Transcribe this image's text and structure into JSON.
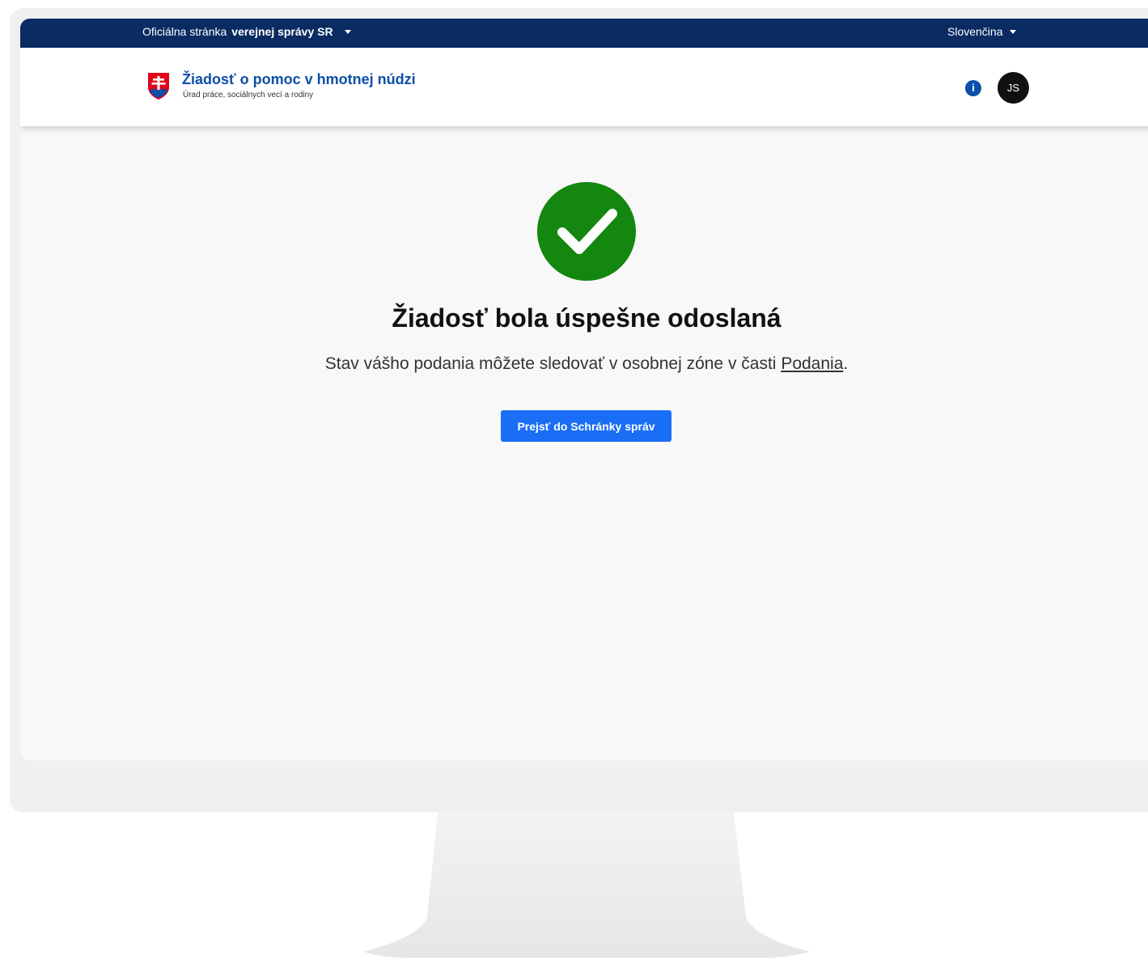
{
  "gov_bar": {
    "official_prefix": "Oficiálna stránka",
    "official_bold": "verejnej správy SR",
    "language": "Slovenčina"
  },
  "header": {
    "title": "Žiadosť o pomoc v hmotnej núdzi",
    "subtitle": "Úrad práce, sociálnych vecí a rodiny",
    "info_icon": "i",
    "avatar_initials": "JS"
  },
  "main": {
    "heading": "Žiadosť bola úspešne odoslaná",
    "message_before": "Stav vášho podania môžete sledovať v osobnej zóne v časti",
    "message_link": "Podania",
    "message_after": ".",
    "button_label": "Prejsť do Schránky správ"
  },
  "icons": {
    "success": "check-circle-icon",
    "crest": "slovak-crest-icon",
    "info": "info-icon"
  },
  "colors": {
    "gov_bar": "#0b2b63",
    "brand_blue": "#0b4fa8",
    "success_green": "#13870f",
    "button_blue": "#1a6ef5",
    "crest_red": "#e2001a"
  }
}
